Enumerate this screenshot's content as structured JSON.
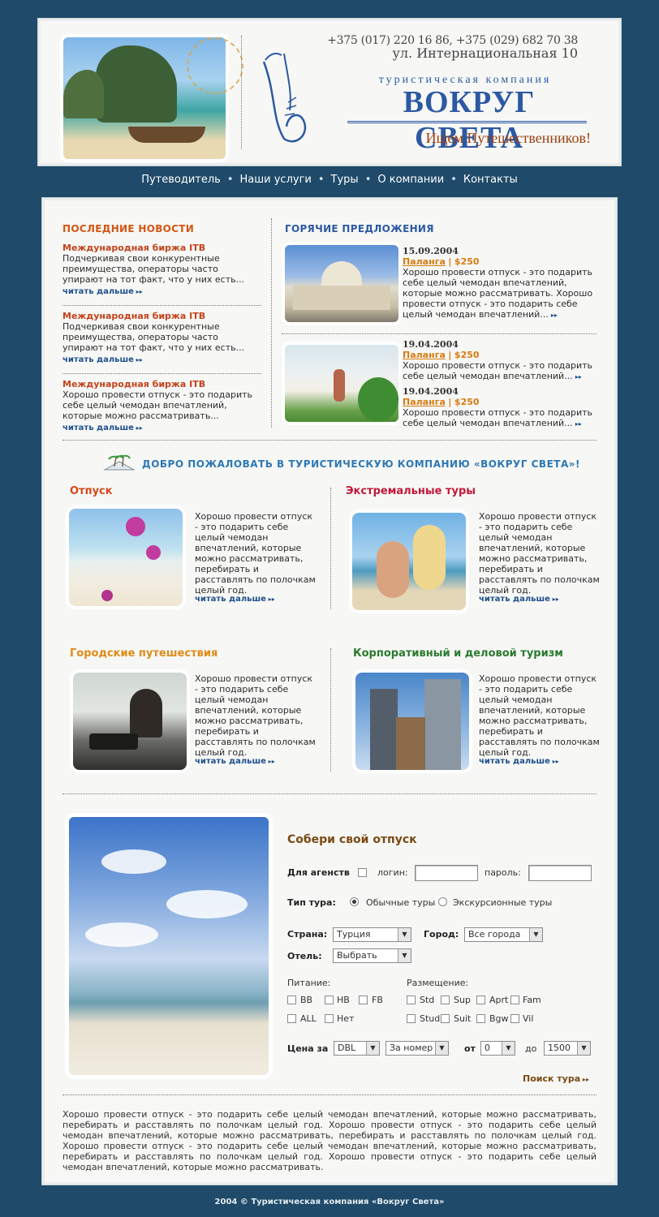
{
  "header": {
    "phone": "+375 (017) 220 16 86, +375 (029) 682 70 38",
    "address": "ул. Интернациональная 10",
    "brand_top": "туристическая компания",
    "brand_name": "ВОКРУГ СВЕТА",
    "slogan": "Ищем Путешественников!"
  },
  "nav": {
    "items": [
      "Путеводитель",
      "Наши услуги",
      "Туры",
      "О компании",
      "Контакты"
    ],
    "separator": "•"
  },
  "news": {
    "title": "ПОСЛЕДНИЕ НОВОСТИ",
    "more": "читать дальше",
    "items": [
      {
        "title": "Международная биржа ITB",
        "text": "Подчеркивая свои конкурентные преимущества, операторы часто упирают на тот факт, что у них есть..."
      },
      {
        "title": "Международная биржа ITB",
        "text": "Подчеркивая свои конкурентные преимущества, операторы часто упирают на тот факт, что у них есть..."
      },
      {
        "title": "Международная биржа ITB",
        "text": "Хорошо провести отпуск - это подарить себе целый чемодан впечатлений, которые можно рассматривать..."
      }
    ]
  },
  "hot": {
    "title": "ГОРЯЧИЕ ПРЕДЛОЖЕНИЯ",
    "sep": "|",
    "offers": [
      {
        "date": "15.09.2004",
        "place": "Паланга",
        "price": "$250",
        "text": "Хорошо провести отпуск - это подарить себе целый чемодан впечатлений, которые можно рассматривать. Хорошо провести отпуск - это подарить себе целый чемодан впечатлений..."
      },
      {
        "date": "19.04.2004",
        "place": "Паланга",
        "price": "$250",
        "text": "Хорошо провести отпуск - это подарить себе целый чемодан впечатлений..."
      },
      {
        "date": "19.04.2004",
        "place": "Паланга",
        "price": "$250",
        "text": "Хорошо провести отпуск - это подарить себе целый чемодан впечатлений..."
      }
    ]
  },
  "welcome": "ДОБРО ПОЖАЛОВАТЬ В ТУРИСТИЧЕСКУЮ КОМПАНИЮ «ВОКРУГ СВЕТА»!",
  "categories": [
    {
      "title": "Отпуск",
      "color": "#d4481a",
      "text": "Хорошо провести отпуск - это подарить себе целый чемодан впечатлений, которые можно рассматривать, перебирать и расставлять по полочкам целый год.",
      "more": "читать дальше"
    },
    {
      "title": "Экстремальные туры",
      "color": "#c2183a",
      "text": "Хорошо провести отпуск - это подарить себе целый чемодан впечатлений, которые можно рассматривать, перебирать и расставлять по полочкам целый год.",
      "more": "читать дальше"
    },
    {
      "title": "Городские путешествия",
      "color": "#e08a16",
      "text": "Хорошо провести отпуск - это подарить себе целый чемодан впечатлений, которые можно рассматривать, перебирать и расставлять по полочкам целый год.",
      "more": "читать дальше"
    },
    {
      "title": "Корпоративный и деловой туризм",
      "color": "#2a7a2e",
      "text": "Хорошо провести отпуск - это подарить себе целый чемодан впечатлений, которые можно рассматривать, перебирать и расставлять по полочкам целый год.",
      "more": "читать дальше"
    }
  ],
  "form": {
    "title": "Собери свой отпуск",
    "agency_label": "Для агенств",
    "login_label": "логин:",
    "password_label": "пароль:",
    "tour_type_label": "Тип тура:",
    "tour_type_options": [
      "Обычные туры",
      "Экскурсионные туры"
    ],
    "country_label": "Страна:",
    "country_value": "Турция",
    "city_label": "Город:",
    "city_value": "Все города",
    "hotel_label": "Отель:",
    "hotel_value": "Выбрать",
    "meal_label": "Питание:",
    "meal_options": [
      "BB",
      "HB",
      "FB",
      "ALL",
      "Нет"
    ],
    "accom_label": "Размещение:",
    "accom_options": [
      "Std",
      "Sup",
      "Aprt",
      "Fam",
      "Stud",
      "Suit",
      "Bgw",
      "Vil"
    ],
    "price_label": "Цена за",
    "price_room_value": "DBL",
    "price_per_value": "За номер",
    "from_label": "от",
    "from_value": "0",
    "to_label": "до",
    "to_value": "1500",
    "search_label": "Поиск тура"
  },
  "bottom_text": "Хорошо провести отпуск - это подарить себе целый чемодан впечатлений, которые можно рассматривать, перебирать и расставлять по полочкам целый год. Хорошо провести отпуск - это подарить себе целый чемодан впечатлений, которые можно рассматривать, перебирать и расставлять по полочкам целый год. Хорошо провести отпуск - это подарить себе целый чемодан впечатлений, которые можно рассматривать, перебирать и расставлять по полочкам целый год. Хорошо провести отпуск - это подарить себе целый чемодан впечатлений, которые можно рассматривать.",
  "footer": "2004 © Туристическая компания «Вокруг Света»"
}
